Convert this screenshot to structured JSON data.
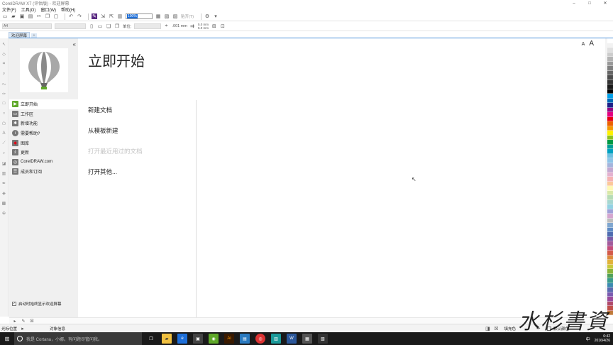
{
  "window": {
    "title": "CorelDRAW X7 (评估版) - 欢迎屏幕",
    "minimize": "–",
    "maximize": "□",
    "close": "✕"
  },
  "menu": [
    "文件(F)",
    "工具(O)",
    "窗口(W)",
    "帮助(H)"
  ],
  "toolbar": {
    "zoom_value": "100%",
    "snap_label": "贴齐(T)"
  },
  "propbar": {
    "paper_size": "A4",
    "units_label": "单位:",
    "nudge_value": ".001 mm",
    "dup_x": "5.0 mm",
    "dup_y": "5.0 mm"
  },
  "tabs": {
    "welcome": "欢迎屏幕",
    "add": "+"
  },
  "side": {
    "collapse": "«",
    "nav": [
      {
        "label": "立即开始",
        "icon": "play-icon",
        "color": "#5fa829"
      },
      {
        "label": "工作区",
        "icon": "monitor-icon",
        "color": "#666666"
      },
      {
        "label": "新增功能",
        "icon": "star-icon",
        "color": "#666666"
      },
      {
        "label": "需要帮助?",
        "icon": "info-icon",
        "color": "#666666"
      },
      {
        "label": "图库",
        "icon": "gallery-icon",
        "color": "#666666"
      },
      {
        "label": "更新",
        "icon": "download-icon",
        "color": "#666666"
      },
      {
        "label": "CorelDRAW.com",
        "icon": "globe-icon",
        "color": "#666666"
      },
      {
        "label": "成员和订阅",
        "icon": "member-icon",
        "color": "#666666"
      }
    ],
    "startup_check": "启动时始终显示欢迎屏幕",
    "startup_checked": "✓"
  },
  "main": {
    "title": "立即开始",
    "font_small": "A",
    "font_large": "A",
    "actions": [
      {
        "label": "新建文档",
        "enabled": true
      },
      {
        "label": "从模板新建",
        "enabled": true
      },
      {
        "label": "打开最近用过的文档",
        "enabled": false
      },
      {
        "label": "打开其他...",
        "enabled": true
      }
    ]
  },
  "status": {
    "cursor_pos": "光标位置",
    "object_info": "对象信息",
    "fill_label": "填充色",
    "outline_label": "默认颜色"
  },
  "taskbar": {
    "search_placeholder": "我是 Cortana，小娜。有问题尽管问我。",
    "ime": "中",
    "time": "6:42",
    "date": "2016/4/26"
  },
  "watermark": "水杉書資",
  "colors": {
    "accent_blue": "#4a90d9",
    "active_green": "#5fa829",
    "palette": [
      "#ffffff",
      "#f2f2f2",
      "#e0e0e0",
      "#cccccc",
      "#b3b3b3",
      "#999999",
      "#808080",
      "#666666",
      "#4d4d4d",
      "#333333",
      "#1a1a1a",
      "#000000",
      "#00a0e9",
      "#0068b7",
      "#1d2088",
      "#920783",
      "#e4007f",
      "#e60012",
      "#eb6100",
      "#f39800",
      "#fff100",
      "#8fc31f",
      "#009944",
      "#009e96",
      "#00a0c1",
      "#6cbfe0",
      "#8dc3e7",
      "#a3b4dc",
      "#c3a8d1",
      "#e4b1cf",
      "#f5b2b2",
      "#fcc89b",
      "#fff8b4",
      "#d9e8a8",
      "#b6dcb6",
      "#a6d7d0",
      "#92d1e3",
      "#9fa0d8",
      "#d4a5cf",
      "#bdbdbd",
      "#7fa6cf",
      "#5e8ac4",
      "#4f6bb0",
      "#7a5aa6",
      "#a35a9b",
      "#c44d7a",
      "#d35a4a",
      "#dc8a3c",
      "#e1b23a",
      "#c8c83a",
      "#8ab43a",
      "#4fa05a",
      "#3a9a8c",
      "#3a8ab0",
      "#5a6ab0",
      "#7a5ab0",
      "#9a4a9a",
      "#b04a6a",
      "#c0504a",
      "#c07a3a"
    ]
  }
}
